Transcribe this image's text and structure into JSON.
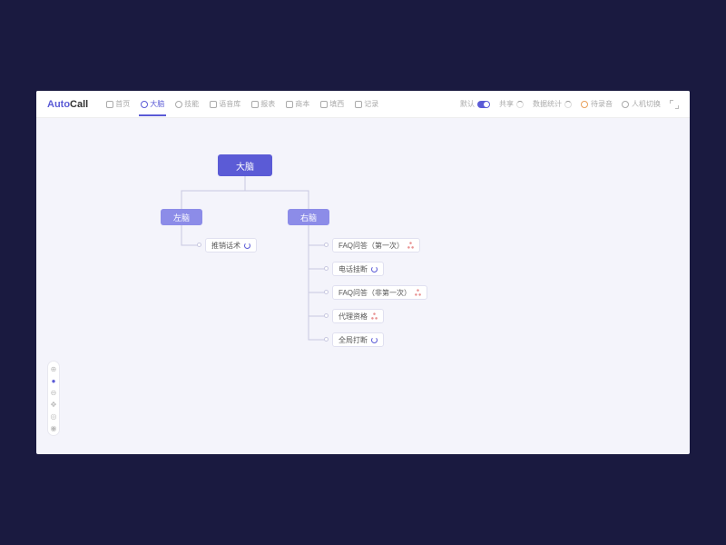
{
  "logo": {
    "part1": "Auto",
    "part2": "Call"
  },
  "nav": [
    {
      "label": "首页",
      "icon": "home"
    },
    {
      "label": "大脑",
      "icon": "brain",
      "active": true
    },
    {
      "label": "技能",
      "icon": "skill"
    },
    {
      "label": "语音库",
      "icon": "voice"
    },
    {
      "label": "报表",
      "icon": "report"
    },
    {
      "label": "商本",
      "icon": "book"
    },
    {
      "label": "填西",
      "icon": "fill"
    },
    {
      "label": "记录",
      "icon": "log"
    }
  ],
  "rightTools": {
    "default": "默认",
    "share": "共享",
    "stats": "数据统计",
    "waiting": "待录音",
    "switch": "人机切换"
  },
  "tree": {
    "root": "大脑",
    "left": {
      "label": "左脑",
      "children": [
        {
          "label": "推销话术",
          "icon": "refresh"
        }
      ]
    },
    "right": {
      "label": "右脑",
      "children": [
        {
          "label": "FAQ问答（第一次）",
          "icon": "fork"
        },
        {
          "label": "电话挂断",
          "icon": "refresh"
        },
        {
          "label": "FAQ问答（非第一次）",
          "icon": "fork"
        },
        {
          "label": "代理资格",
          "icon": "fork"
        },
        {
          "label": "全局打断",
          "icon": "refresh"
        }
      ]
    }
  },
  "toolbar": [
    "zoom-in",
    "select",
    "zoom-out",
    "pan",
    "fit",
    "view"
  ]
}
